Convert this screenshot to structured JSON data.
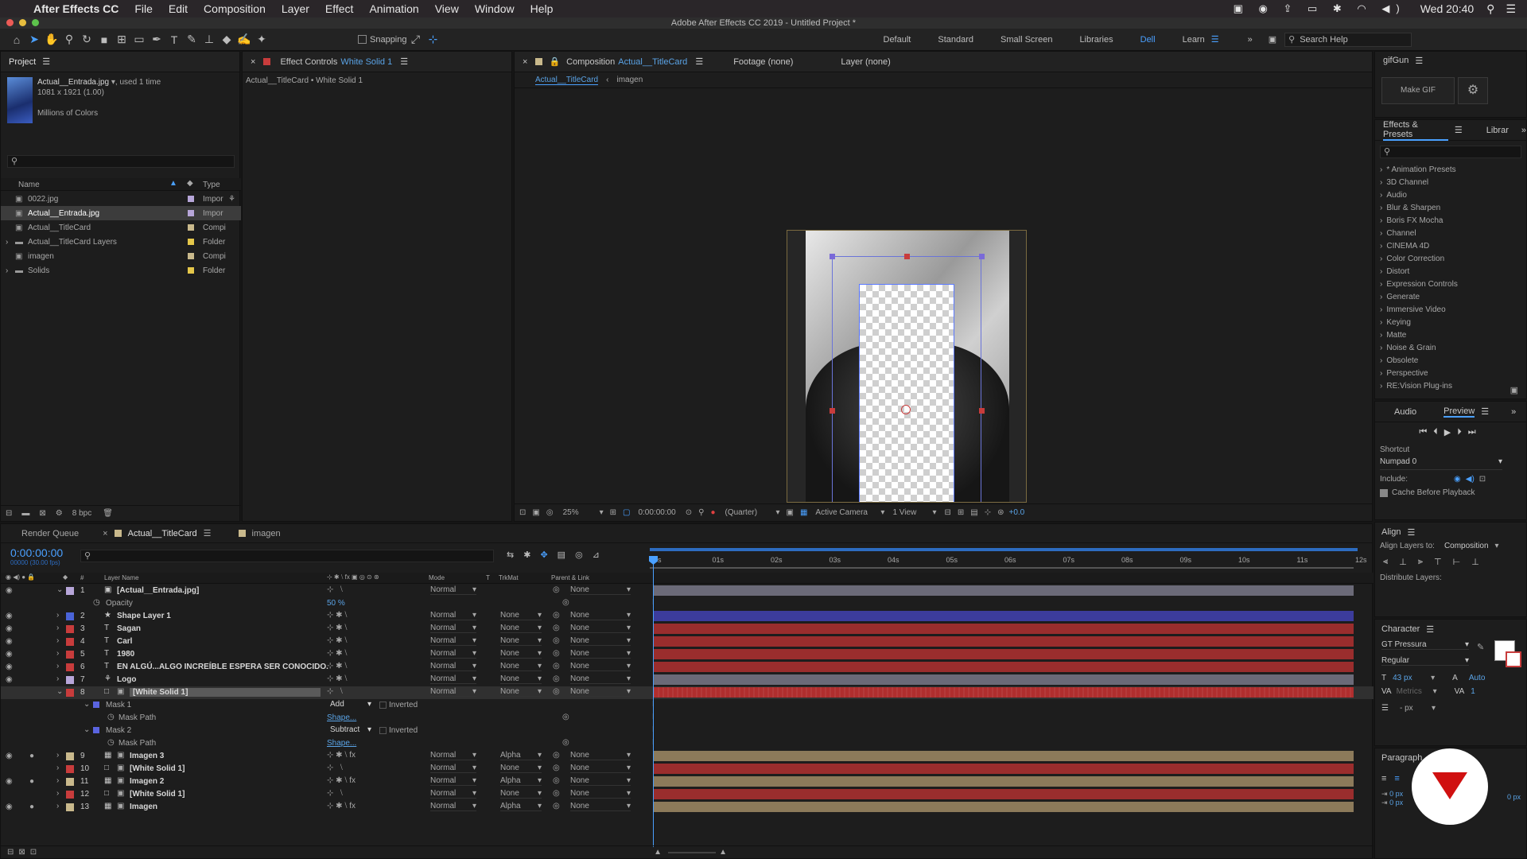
{
  "menubar": {
    "app": "After Effects CC",
    "items": [
      "File",
      "Edit",
      "Composition",
      "Layer",
      "Effect",
      "Animation",
      "View",
      "Window",
      "Help"
    ],
    "clock": "Wed 20:40"
  },
  "title": "Adobe After Effects CC 2019 - Untitled Project *",
  "toolbar": {
    "snapping": "Snapping",
    "workspaces": [
      "Default",
      "Standard",
      "Small Screen",
      "Libraries",
      "Dell",
      "Learn"
    ],
    "search": "Search Help"
  },
  "project": {
    "title": "Project",
    "item_name": "Actual__Entrada.jpg",
    "used": ", used 1 time",
    "dims": "1081 x 1921 (1.00)",
    "colors": "Millions of Colors",
    "col_name": "Name",
    "col_type": "Type",
    "bpc": "8 bpc",
    "items": [
      {
        "name": "0022.jpg",
        "type": "Impor",
        "color": "#b7a6d9"
      },
      {
        "name": "Actual__Entrada.jpg",
        "type": "Impor",
        "color": "#b7a6d9"
      },
      {
        "name": "Actual__TitleCard",
        "type": "Compi",
        "color": "#c9b98c"
      },
      {
        "name": "Actual__TitleCard Layers",
        "type": "Folder",
        "color": "#e5c74a"
      },
      {
        "name": "imagen",
        "type": "Compi",
        "color": "#c9b98c"
      },
      {
        "name": "Solids",
        "type": "Folder",
        "color": "#e5c74a"
      }
    ]
  },
  "effect_controls": {
    "tab": "Effect Controls",
    "layer": "White Solid 1",
    "path": "Actual__TitleCard • White Solid 1"
  },
  "comp": {
    "tab": "Composition",
    "name": "Actual__TitleCard",
    "footage": "Footage (none)",
    "layer": "Layer (none)",
    "crumbs": [
      "Actual__TitleCard",
      "imagen"
    ],
    "zoom": "25%",
    "time": "0:00:00:00",
    "quality": "(Quarter)",
    "camera": "Active Camera",
    "view": "1 View",
    "offset": "+0.0"
  },
  "gifgun": {
    "title": "gifGun",
    "make": "Make GIF"
  },
  "effects": {
    "tab": "Effects & Presets",
    "tab2": "Librar",
    "items": [
      "* Animation Presets",
      "3D Channel",
      "Audio",
      "Blur & Sharpen",
      "Boris FX Mocha",
      "Channel",
      "CINEMA 4D",
      "Color Correction",
      "Distort",
      "Expression Controls",
      "Generate",
      "Immersive Video",
      "Keying",
      "Matte",
      "Noise & Grain",
      "Obsolete",
      "Perspective",
      "RE:Vision Plug-ins"
    ]
  },
  "preview": {
    "audio": "Audio",
    "tab": "Preview",
    "shortcut_label": "Shortcut",
    "shortcut": "Numpad 0",
    "include": "Include:",
    "cache": "Cache Before Playback"
  },
  "align": {
    "title": "Align",
    "layers_to": "Align Layers to:",
    "target": "Composition",
    "distribute": "Distribute Layers:"
  },
  "character": {
    "title": "Character",
    "font": "GT Pressura",
    "style": "Regular",
    "size": "43 px",
    "leading": "Auto",
    "tracking_label": "Metrics",
    "tracking": "1",
    "unit": "- px"
  },
  "paragraph": {
    "title": "Paragraph",
    "v1": "0 px",
    "v2": "0 px",
    "v3": "0 px"
  },
  "timeline": {
    "render_queue": "Render Queue",
    "tab": "Actual__TitleCard",
    "tab2": "imagen",
    "time": "0:00:00:00",
    "fps": "00000 (30.00 fps)",
    "col_layer": "Layer Name",
    "col_mode": "Mode",
    "col_t": "T",
    "col_trkmat": "TrkMat",
    "col_parent": "Parent & Link",
    "ruler": [
      "0s",
      "01s",
      "02s",
      "03s",
      "04s",
      "05s",
      "06s",
      "07s",
      "08s",
      "09s",
      "10s",
      "11s",
      "12s"
    ],
    "rows": [
      {
        "kind": "layer",
        "num": "1",
        "name": "[Actual__Entrada.jpg]",
        "label": "#b7a6d9",
        "icon": "img",
        "mode": "Normal",
        "trk": "",
        "parent": "None",
        "bar": "#6b6a78",
        "eye": true
      },
      {
        "kind": "prop",
        "name": "Opacity",
        "value": "50 %"
      },
      {
        "kind": "layer",
        "num": "2",
        "name": "Shape Layer 1",
        "label": "#4a64d8",
        "icon": "star",
        "mode": "Normal",
        "trk": "None",
        "parent": "None",
        "bar": "#3c3c9c",
        "eye": true
      },
      {
        "kind": "layer",
        "num": "3",
        "name": "Sagan",
        "label": "#c83c3c",
        "icon": "T",
        "mode": "Normal",
        "trk": "None",
        "parent": "None",
        "bar": "#9a2d2d",
        "eye": true
      },
      {
        "kind": "layer",
        "num": "4",
        "name": "Carl",
        "label": "#c83c3c",
        "icon": "T",
        "mode": "Normal",
        "trk": "None",
        "parent": "None",
        "bar": "#9a2d2d",
        "eye": true
      },
      {
        "kind": "layer",
        "num": "5",
        "name": "1980",
        "label": "#c83c3c",
        "icon": "T",
        "mode": "Normal",
        "trk": "None",
        "parent": "None",
        "bar": "#9a2d2d",
        "eye": true
      },
      {
        "kind": "layer",
        "num": "6",
        "name": "EN ALGÚ...ALGO INCREÍBLE ESPERA SER CONOCIDO.",
        "label": "#c83c3c",
        "icon": "T",
        "mode": "Normal",
        "trk": "None",
        "parent": "None",
        "bar": "#9a2d2d",
        "eye": true
      },
      {
        "kind": "layer",
        "num": "7",
        "name": "Logo",
        "label": "#b7a6d9",
        "icon": "ai",
        "mode": "Normal",
        "trk": "None",
        "parent": "None",
        "bar": "#6b6a78",
        "eye": true
      },
      {
        "kind": "layer",
        "num": "8",
        "name": "[White Solid 1]",
        "label": "#c83c3c",
        "icon": "solid",
        "mode": "Normal",
        "trk": "None",
        "parent": "None",
        "bar": "#b02e2e",
        "eye": false,
        "sel": true
      },
      {
        "kind": "mask",
        "name": "Mask 1",
        "mmode": "Add",
        "inv": "Inverted"
      },
      {
        "kind": "prop",
        "name": "Mask Path",
        "value": "Shape..."
      },
      {
        "kind": "mask",
        "name": "Mask 2",
        "mmode": "Subtract",
        "inv": "Inverted"
      },
      {
        "kind": "prop",
        "name": "Mask Path",
        "value": "Shape..."
      },
      {
        "kind": "layer",
        "num": "9",
        "name": "Imagen 3",
        "label": "#c9b98c",
        "icon": "comp",
        "mode": "Normal",
        "trk": "Alpha",
        "parent": "None",
        "bar": "#8c7a5a",
        "eye": true,
        "fx": true
      },
      {
        "kind": "layer",
        "num": "10",
        "name": "[White Solid 1]",
        "label": "#c83c3c",
        "icon": "solid",
        "mode": "Normal",
        "trk": "None",
        "parent": "None",
        "bar": "#9a2d2d",
        "eye": false
      },
      {
        "kind": "layer",
        "num": "11",
        "name": "Imagen 2",
        "label": "#c9b98c",
        "icon": "comp",
        "mode": "Normal",
        "trk": "Alpha",
        "parent": "None",
        "bar": "#8c7a5a",
        "eye": true,
        "fx": true
      },
      {
        "kind": "layer",
        "num": "12",
        "name": "[White Solid 1]",
        "label": "#c83c3c",
        "icon": "solid",
        "mode": "Normal",
        "trk": "None",
        "parent": "None",
        "bar": "#9a2d2d",
        "eye": false
      },
      {
        "kind": "layer",
        "num": "13",
        "name": "Imagen",
        "label": "#c9b98c",
        "icon": "comp",
        "mode": "Normal",
        "trk": "Alpha",
        "parent": "None",
        "bar": "#8c7a5a",
        "eye": true,
        "fx": true
      }
    ]
  },
  "colors": {
    "accent": "#2d8ceb",
    "selection": "#3c3c3c"
  }
}
